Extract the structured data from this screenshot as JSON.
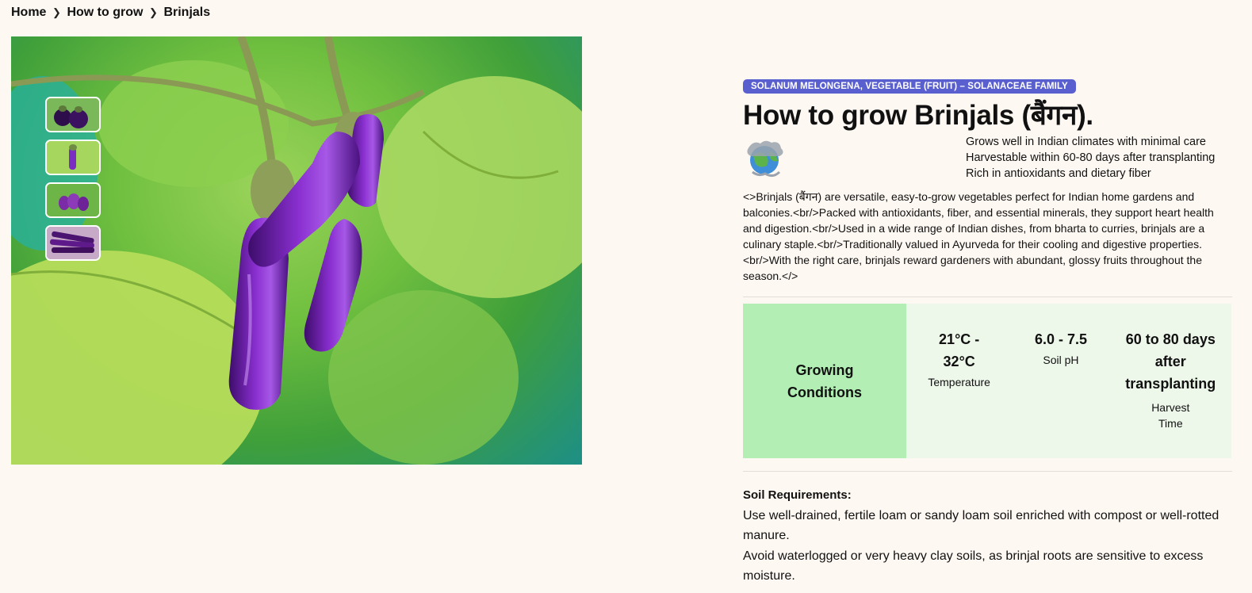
{
  "breadcrumb": {
    "items": [
      "Home",
      "How to grow",
      "Brinjals"
    ]
  },
  "gallery": {
    "thumbnails": [
      {
        "name": "brinjal-round-dark"
      },
      {
        "name": "brinjal-single-hanging"
      },
      {
        "name": "brinjal-cluster-plant"
      },
      {
        "name": "brinjal-long-pile"
      }
    ]
  },
  "plant": {
    "tag": "SOLANUM MELONGENA, VEGETABLE (FRUIT) – SOLANACEAE FAMILY",
    "title": "How to grow Brinjals (बैंगन).",
    "highlights": [
      "Grows well in Indian climates with minimal care",
      "Harvestable within 60-80 days after transplanting",
      "Rich in antioxidants and dietary fiber"
    ],
    "description": "<>Brinjals (बैंगन) are versatile, easy-to-grow vegetables perfect for Indian home gardens and balconies.<br/>Packed with antioxidants, fiber, and essential minerals, they support heart health and digestion.<br/>Used in a wide range of Indian dishes, from bharta to curries, brinjals are a culinary staple.<br/>Traditionally valued in Ayurveda for their cooling and digestive properties.<br/>With the right care, brinjals reward gardeners with abundant, glossy fruits throughout the season.</>"
  },
  "conditions": {
    "heading": "Growing Conditions",
    "temperature": {
      "value": "21°C - 32°C",
      "label": "Temperature"
    },
    "ph": {
      "value": "6.0 - 7.5",
      "label": "Soil pH"
    },
    "harvest": {
      "value": "60 to 80 days after transplanting",
      "label": "Harvest Time"
    }
  },
  "soil": {
    "heading": "Soil Requirements:",
    "lines": [
      "Use well-drained, fertile loam or sandy loam soil enriched with compost or well-rotted manure.",
      "Avoid waterlogged or very heavy clay soils, as brinjal roots are sensitive to excess moisture."
    ]
  },
  "colors": {
    "tag_bg": "#5a5fcf",
    "conditions_head_bg": "#b3eeb4",
    "conditions_body_bg": "#eef8ea",
    "page_bg": "#fef8f2",
    "brinjal_purple": "#6a1fa0"
  }
}
